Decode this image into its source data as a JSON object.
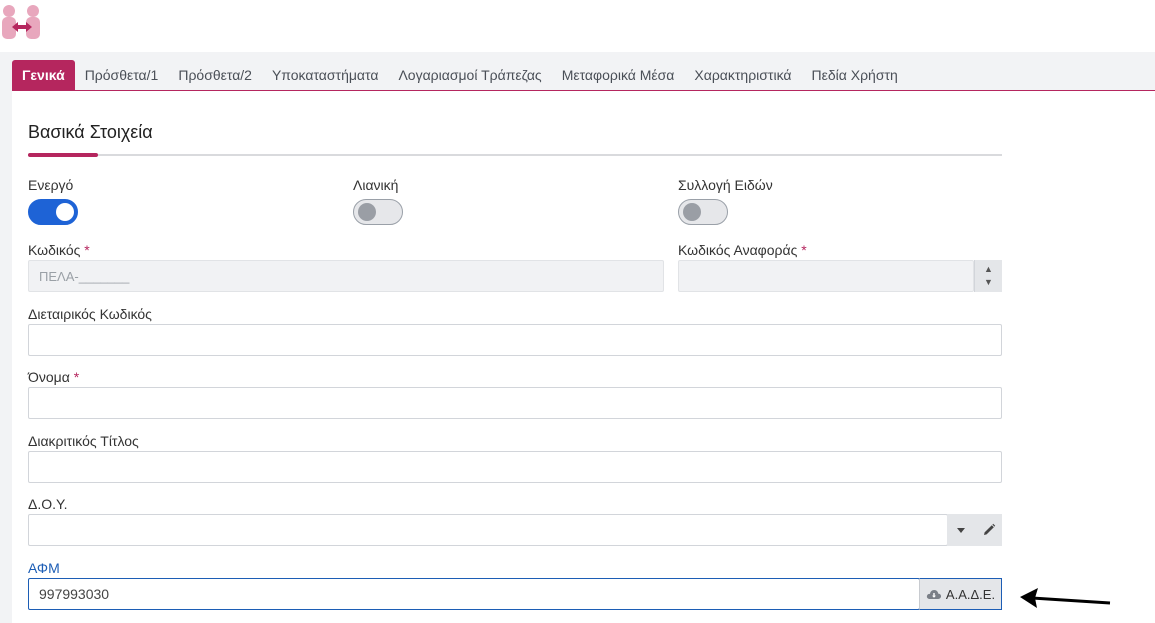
{
  "app": {
    "logo": "company-logo-icon"
  },
  "tabs": [
    {
      "label": "Γενικά",
      "active": true
    },
    {
      "label": "Πρόσθετα/1"
    },
    {
      "label": "Πρόσθετα/2"
    },
    {
      "label": "Υποκαταστήματα"
    },
    {
      "label": "Λογαριασμοί Τράπεζας"
    },
    {
      "label": "Μεταφορικά Μέσα"
    },
    {
      "label": "Χαρακτηριστικά"
    },
    {
      "label": "Πεδία Χρήστη"
    }
  ],
  "section": {
    "title": "Βασικά Στοιχεία"
  },
  "toggles": {
    "active": {
      "label": "Ενεργό",
      "on": true
    },
    "retail": {
      "label": "Λιανική",
      "on": false
    },
    "item_collection": {
      "label": "Συλλογή Ειδών",
      "on": false
    }
  },
  "fields": {
    "code": {
      "label": "Κωδικός",
      "required_mark": "*",
      "placeholder": "ΠΕΛΑ-_______",
      "value": ""
    },
    "reference_code": {
      "label": "Κωδικός Αναφοράς",
      "required_mark": "*",
      "value": ""
    },
    "company_code": {
      "label": "Διεταιρικός Κωδικός",
      "value": ""
    },
    "name": {
      "label": "Όνομα",
      "required_mark": "*",
      "value": ""
    },
    "trade_title": {
      "label": "Διακριτικός Τίτλος",
      "value": ""
    },
    "tax_office": {
      "label": "Δ.Ο.Υ.",
      "value": ""
    },
    "vat_number": {
      "label": "ΑΦΜ",
      "value": "997993030"
    }
  },
  "buttons": {
    "aade": "Α.Α.Δ.Ε."
  },
  "colors": {
    "accent": "#b5265e",
    "primary": "#1e63d6",
    "focus": "#1c5db5"
  }
}
